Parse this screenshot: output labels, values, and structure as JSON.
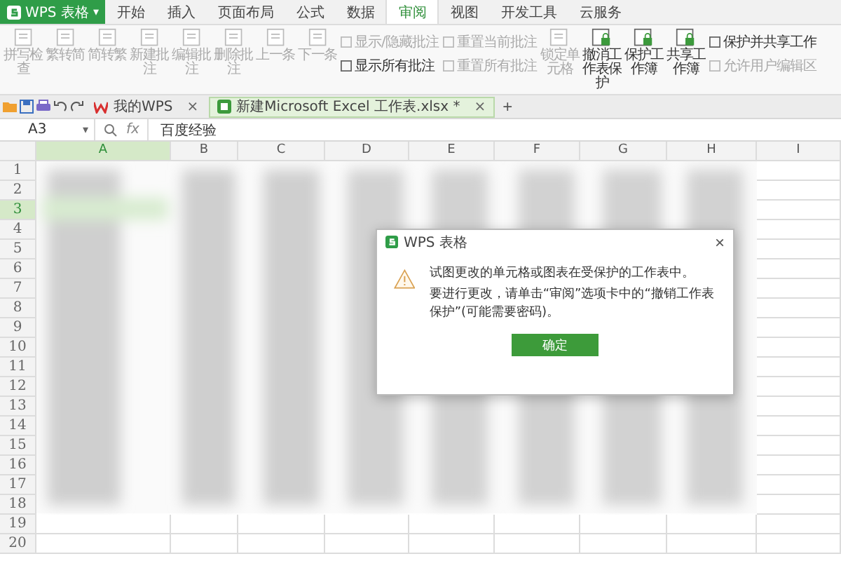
{
  "app_menu": {
    "label": "WPS 表格",
    "caret": "▾"
  },
  "menu_tabs": [
    {
      "label": "开始",
      "selected": false
    },
    {
      "label": "插入",
      "selected": false
    },
    {
      "label": "页面布局",
      "selected": false
    },
    {
      "label": "公式",
      "selected": false
    },
    {
      "label": "数据",
      "selected": false
    },
    {
      "label": "审阅",
      "selected": true
    },
    {
      "label": "视图",
      "selected": false
    },
    {
      "label": "开发工具",
      "selected": false
    },
    {
      "label": "云服务",
      "selected": false
    }
  ],
  "ribbon": [
    {
      "kind": "large",
      "label": "拼写检查",
      "disabled": true
    },
    {
      "kind": "large",
      "label": "繁转简",
      "disabled": true
    },
    {
      "kind": "large",
      "label": "简转繁",
      "disabled": true
    },
    {
      "kind": "large",
      "label": "新建批注",
      "disabled": true
    },
    {
      "kind": "large",
      "label": "编辑批注",
      "disabled": true
    },
    {
      "kind": "large",
      "label": "删除批注",
      "disabled": true
    },
    {
      "kind": "large",
      "label": "上一条",
      "disabled": true
    },
    {
      "kind": "large",
      "label": "下一条",
      "disabled": true
    },
    {
      "kind": "stack",
      "items": [
        {
          "label": "显示/隐藏批注",
          "disabled": true
        },
        {
          "label": "显示所有批注",
          "disabled": false
        }
      ]
    },
    {
      "kind": "stack",
      "items": [
        {
          "label": "重置当前批注",
          "disabled": true
        },
        {
          "label": "重置所有批注",
          "disabled": true
        }
      ]
    },
    {
      "kind": "large",
      "label": "锁定单元格",
      "disabled": true
    },
    {
      "kind": "large",
      "label": "撤消工作表保护",
      "disabled": false
    },
    {
      "kind": "large",
      "label": "保护工作簿",
      "disabled": false
    },
    {
      "kind": "large",
      "label": "共享工作簿",
      "disabled": false
    },
    {
      "kind": "stack",
      "items": [
        {
          "label": "保护并共享工作",
          "disabled": false
        },
        {
          "label": "允许用户编辑区",
          "disabled": true
        }
      ]
    }
  ],
  "doc_tabs": [
    {
      "label": "我的WPS",
      "selected": false,
      "close": "×"
    },
    {
      "label": "新建Microsoft Excel 工作表.xlsx *",
      "selected": true,
      "close": "×"
    }
  ],
  "new_tab": "+",
  "formula_bar": {
    "cell": "A3",
    "caret": "▾",
    "fx": "fx",
    "value": "百度经验"
  },
  "sheet": {
    "columns": [
      {
        "label": "A",
        "selected": true
      },
      {
        "label": "B",
        "selected": false
      },
      {
        "label": "C",
        "selected": false
      },
      {
        "label": "D",
        "selected": false
      },
      {
        "label": "E",
        "selected": false
      },
      {
        "label": "F",
        "selected": false
      },
      {
        "label": "G",
        "selected": false
      },
      {
        "label": "H",
        "selected": false
      },
      {
        "label": "I",
        "selected": false
      }
    ],
    "rows": [
      {
        "label": "1",
        "selected": false
      },
      {
        "label": "2",
        "selected": false
      },
      {
        "label": "3",
        "selected": true
      },
      {
        "label": "4",
        "selected": false
      },
      {
        "label": "5",
        "selected": false
      },
      {
        "label": "6",
        "selected": false
      },
      {
        "label": "7",
        "selected": false
      },
      {
        "label": "8",
        "selected": false
      },
      {
        "label": "9",
        "selected": false
      },
      {
        "label": "10",
        "selected": false
      },
      {
        "label": "11",
        "selected": false
      },
      {
        "label": "12",
        "selected": false
      },
      {
        "label": "13",
        "selected": false
      },
      {
        "label": "14",
        "selected": false
      },
      {
        "label": "15",
        "selected": false
      },
      {
        "label": "16",
        "selected": false
      },
      {
        "label": "17",
        "selected": false
      },
      {
        "label": "18",
        "selected": false
      },
      {
        "label": "19",
        "selected": false
      },
      {
        "label": "20",
        "selected": false
      }
    ]
  },
  "dialog": {
    "title": "WPS 表格",
    "close": "×",
    "messages": [
      "试图更改的单元格或图表在受保护的工作表中。",
      "要进行更改，请单击“审阅”选项卡中的“撤销工作表保护”(可能需要密码)。"
    ],
    "button": "确定"
  }
}
